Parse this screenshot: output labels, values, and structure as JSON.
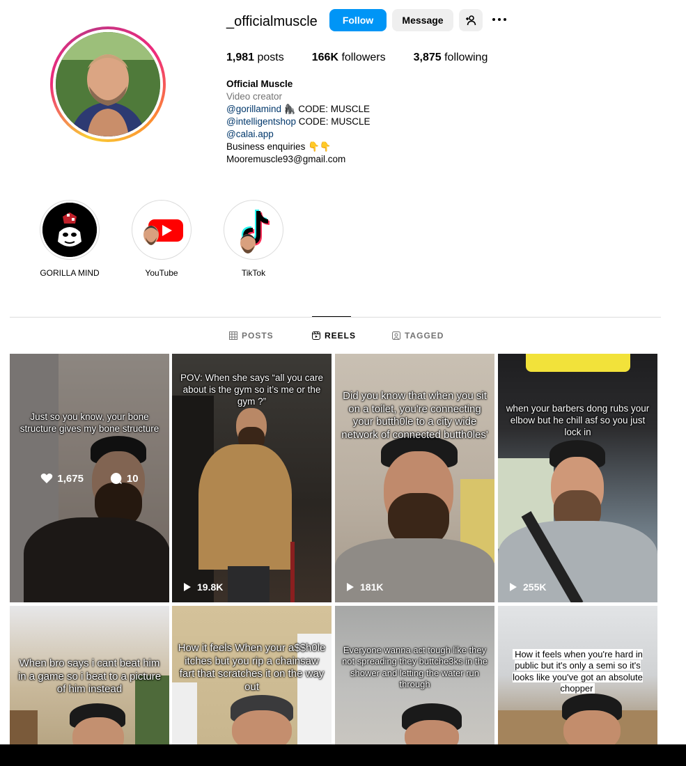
{
  "profile": {
    "username": "_officialmuscle",
    "follow_label": "Follow",
    "message_label": "Message",
    "stats": {
      "posts_count": "1,981",
      "posts_label": "posts",
      "followers_count": "166K",
      "followers_label": "followers",
      "following_count": "3,875",
      "following_label": "following"
    },
    "bio": {
      "name": "Official Muscle",
      "category": "Video creator",
      "line1_link": "@gorillamind",
      "line1_rest": " 🦍 CODE: MUSCLE",
      "line2_link": "@intelligentshop",
      "line2_rest": " CODE: MUSCLE",
      "line3_link": "@calai.app",
      "line4": "Business enquiries 👇👇",
      "line5": "Mooremuscle93@gmail.com"
    }
  },
  "highlights": [
    {
      "label": "GORILLA MIND",
      "icon": "gorilla-icon"
    },
    {
      "label": "YouTube",
      "icon": "youtube-icon"
    },
    {
      "label": "TikTok",
      "icon": "tiktok-icon"
    }
  ],
  "tabs": [
    {
      "label": "POSTS",
      "icon": "grid-icon",
      "active": false
    },
    {
      "label": "REELS",
      "icon": "reels-icon",
      "active": true
    },
    {
      "label": "TAGGED",
      "icon": "tagged-icon",
      "active": false
    }
  ],
  "reels": [
    {
      "caption": "Just so you know, your bone structure gives my bone structure",
      "likes": "1,675",
      "comments": "10",
      "hovered": true
    },
    {
      "caption": "POV: When she says “all you care about is the gym so it’s me or the gym ?”",
      "views": "19.8K"
    },
    {
      "caption": "Did you know that when you sit on a toilet, you're connecting your butth0le to a city wide network of connected butth0les'",
      "views": "181K"
    },
    {
      "caption": "when your barbers dong rubs your elbow but he chill asf so you just lock in",
      "views": "255K"
    },
    {
      "caption": "When bro says i cant beat him in a game so i beat to a picture of him instead"
    },
    {
      "caption": "How it feels When your a$$h0le itches but you rip a chainsaw fart that scratches it on the way out"
    },
    {
      "caption": "Everyone wanna act tough like they not spreading they buttche3ks in the shower and letting the water run through"
    },
    {
      "caption": "How it feels when you're hard in public but it's only a semi so it's looks like you've got an absolute chopper"
    }
  ],
  "colors": {
    "follow": "#0095f6",
    "link": "#00376b",
    "secondary_text": "#737373"
  }
}
